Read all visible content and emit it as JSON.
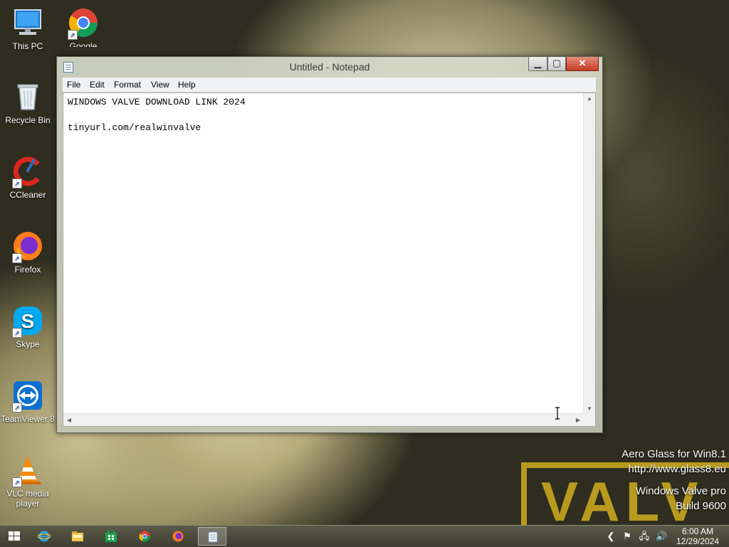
{
  "desktop": {
    "icons": [
      {
        "label": "This PC"
      },
      {
        "label": "Google Chrome"
      },
      {
        "label": "Recycle Bin"
      },
      {
        "label": "CCleaner"
      },
      {
        "label": "Firefox"
      },
      {
        "label": "Skype"
      },
      {
        "label": "TeamViewer 8"
      },
      {
        "label": "VLC media player"
      }
    ],
    "wallpaper_text": "VALV",
    "watermark": {
      "line1": "Aero Glass for Win8.1",
      "line2": "http://www.glass8.eu",
      "line3": "Windows Valve pro",
      "line4": "Build 9600"
    }
  },
  "notepad": {
    "title": "Untitled - Notepad",
    "min_glyph": "▁",
    "max_glyph": "▢",
    "close_glyph": "✕",
    "menu": {
      "file": "File",
      "edit": "Edit",
      "format": "Format",
      "view": "View",
      "help": "Help"
    },
    "content": {
      "line1": "WINDOWS VALVE DOWNLOAD LINK 2024",
      "line2": "tinyurl.com/realwinvalve"
    }
  },
  "taskbar": {
    "apps": [
      "start-icon",
      "internet-explorer-icon",
      "file-explorer-icon",
      "store-icon",
      "chrome-icon",
      "firefox-icon",
      "notepad-icon"
    ],
    "clock": {
      "time": "6:00 AM",
      "date": "12/29/2024"
    }
  },
  "colors": {
    "close_button": "#c63d25",
    "valve_logo": "#b89a1e"
  }
}
